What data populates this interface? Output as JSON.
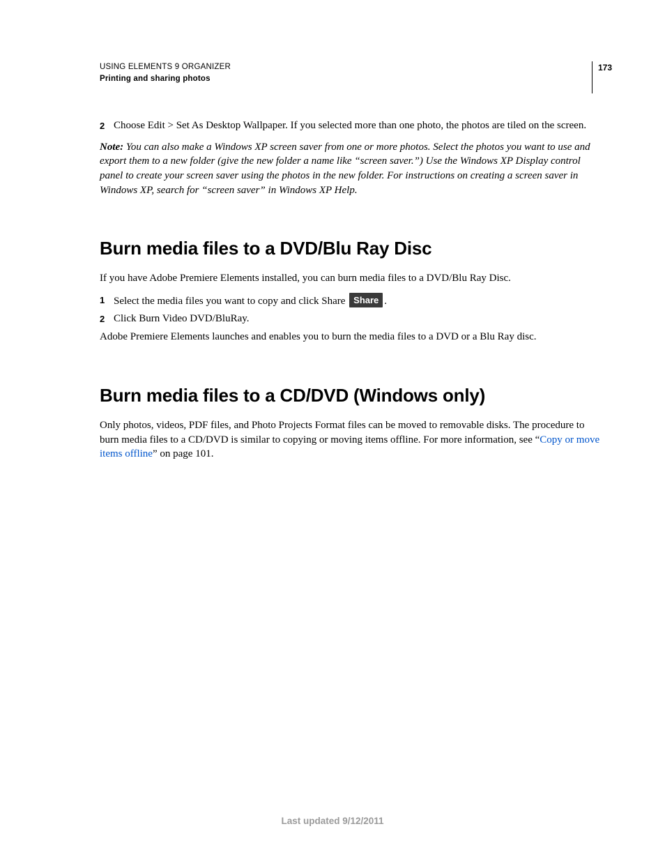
{
  "header": {
    "line1": "USING ELEMENTS 9 ORGANIZER",
    "line2": "Printing and sharing photos",
    "page_number": "173"
  },
  "intro": {
    "step2_num": "2",
    "step2_text": "Choose Edit > Set As Desktop Wallpaper. If you selected more than one photo, the photos are tiled on the screen.",
    "note_label": "Note: ",
    "note_text": "You can also make a Windows XP screen saver from one or more photos. Select the photos you want to use and export them to a new folder (give the new folder a name like “screen saver.”) Use the Windows XP Display control panel to create your screen saver using the photos in the new folder. For instructions on creating a screen saver in Windows XP, search for “screen saver” in Windows XP Help."
  },
  "section1": {
    "heading": "Burn media files to a DVD/Blu Ray Disc",
    "p1": "If you have Adobe Premiere Elements installed, you can burn media files to a DVD/Blu Ray Disc.",
    "step1_num": "1",
    "step1_pre": "Select the media files you want to copy and click Share ",
    "share_label": "Share",
    "step1_post": ".",
    "step2_num": "2",
    "step2_text": "Click Burn Video DVD/BluRay.",
    "p2": "Adobe Premiere Elements launches and enables you to burn the media files to a DVD or a Blu Ray disc."
  },
  "section2": {
    "heading": "Burn media files to a CD/DVD (Windows only)",
    "p_pre": "Only photos, videos, PDF files, and Photo Projects Format files can be moved to removable disks. The procedure to burn media files to a CD/DVD is similar to copying or moving items offline. For more information, see “",
    "link_text": "Copy or move items offline",
    "p_post": "” on page 101."
  },
  "footer": "Last updated 9/12/2011"
}
